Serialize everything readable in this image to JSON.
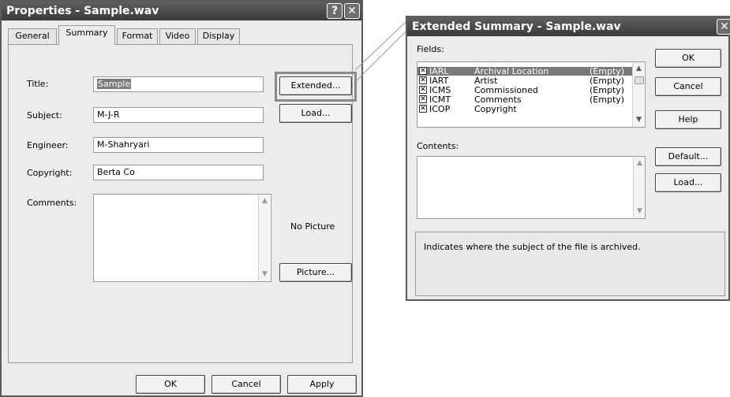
{
  "properties": {
    "title": "Properties - Sample.wav",
    "tabs": [
      "General",
      "Summary",
      "Format",
      "Video",
      "Display"
    ],
    "active_tab": "Summary",
    "fields": {
      "title_label": "Title:",
      "title_value": "Sample",
      "subject_label": "Subject:",
      "subject_value": "M-J-R",
      "engineer_label": "Engineer:",
      "engineer_value": "M-Shahryari",
      "copyright_label": "Copyright:",
      "copyright_value": "Berta Co",
      "comments_label": "Comments:",
      "comments_value": ""
    },
    "extended_button": "Extended...",
    "load_button": "Load...",
    "no_picture": "No Picture",
    "picture_button": "Picture...",
    "footer": {
      "ok": "OK",
      "cancel": "Cancel",
      "apply": "Apply"
    }
  },
  "extended": {
    "title": "Extended Summary - Sample.wav",
    "fields_label": "Fields:",
    "list": [
      {
        "code": "IARL",
        "name": "Archival Location",
        "value": "(Empty)",
        "checked": true,
        "selected": true
      },
      {
        "code": "IART",
        "name": "Artist",
        "value": "(Empty)",
        "checked": true,
        "selected": false
      },
      {
        "code": "ICMS",
        "name": "Commissioned",
        "value": "(Empty)",
        "checked": true,
        "selected": false
      },
      {
        "code": "ICMT",
        "name": "Comments",
        "value": "(Empty)",
        "checked": true,
        "selected": false
      },
      {
        "code": "ICOP",
        "name": "Copyright",
        "value": "",
        "checked": true,
        "selected": false
      }
    ],
    "contents_label": "Contents:",
    "contents_value": "",
    "description": "Indicates where the subject of the file is archived.",
    "buttons": {
      "ok": "OK",
      "cancel": "Cancel",
      "help": "Help",
      "default": "Default...",
      "load": "Load..."
    }
  },
  "colors": {
    "titlebar": "#4a4a4a",
    "highlight": "#7a7a7a",
    "dialog_bg": "#ececec"
  }
}
